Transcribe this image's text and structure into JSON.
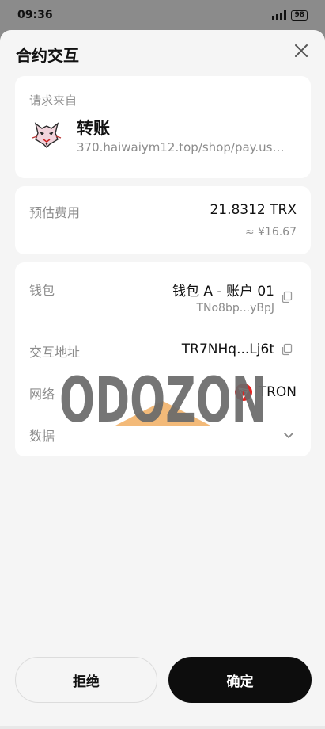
{
  "status_bar": {
    "time": "09:36",
    "battery": "98"
  },
  "sheet": {
    "title": "合约交互"
  },
  "source": {
    "label": "请求来自",
    "title": "转账",
    "url": "370.haiwaiym12.top/shop/pay.us…"
  },
  "fee": {
    "label": "预估费用",
    "value": "21.8312 TRX",
    "fiat": "≈ ¥16.67"
  },
  "details": {
    "wallet_label": "钱包",
    "wallet_value": "钱包 A - 账户 01",
    "wallet_address": "TNo8bp...yBpJ",
    "interact_label": "交互地址",
    "interact_value": "TR7NHq...Lj6t",
    "network_label": "网络",
    "network_value": "TRON",
    "data_label": "数据"
  },
  "watermark": {
    "text": "ODOZON"
  },
  "buttons": {
    "reject": "拒绝",
    "confirm": "确定"
  },
  "colors": {
    "tron": "#e5211f",
    "confirm_bg": "#0d0d0d",
    "watermark": "#6a6a6a",
    "watermark_accent": "#f2b36a"
  },
  "icons": [
    "signal-icon",
    "battery-icon",
    "close-icon",
    "dapp-avatar-icon",
    "copy-icon",
    "tron-logo-icon",
    "chevron-down-icon"
  ]
}
